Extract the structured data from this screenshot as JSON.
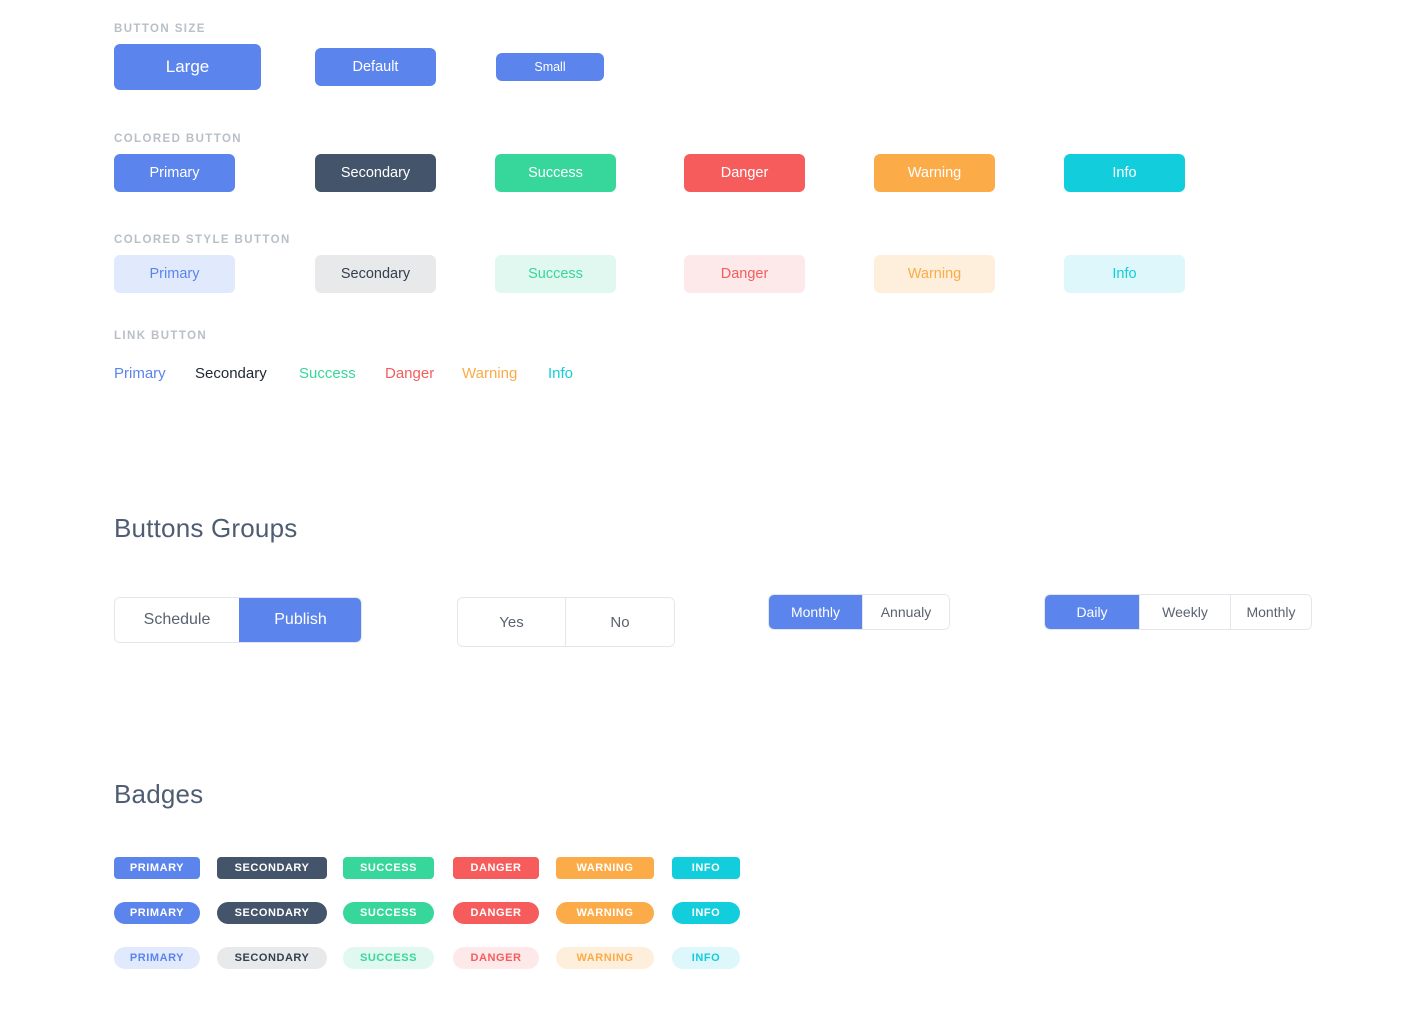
{
  "palette": {
    "primary": "#5b84ec",
    "secondary": "#44546b",
    "success": "#37d79b",
    "danger": "#f75c5c",
    "warning": "#fbab48",
    "info": "#12cedd",
    "primary_soft_bg": "#e1eafd",
    "secondary_soft_bg": "#e8e9eb",
    "success_soft_bg": "#e0f8ef",
    "danger_soft_bg": "#fde9e9",
    "warning_soft_bg": "#fdefdc",
    "info_soft_bg": "#ddf7fa",
    "secondary_soft_text": "#33404f",
    "link_secondary": "#1f2733",
    "label_gray": "#b9bfc7",
    "heading": "#4f5d73",
    "segment_text": "#5a6270",
    "segment_border": "#e3e7ec",
    "page_bg": "#ffffff"
  },
  "sections": {
    "button_size": {
      "label": "BUTTON SIZE",
      "buttons": [
        {
          "label": "Large",
          "size": "large"
        },
        {
          "label": "Default",
          "size": "default"
        },
        {
          "label": "Small",
          "size": "small"
        }
      ]
    },
    "colored_button": {
      "label": "COLORED BUTTON",
      "buttons": [
        {
          "label": "Primary",
          "variant": "primary"
        },
        {
          "label": "Secondary",
          "variant": "secondary"
        },
        {
          "label": "Success",
          "variant": "success"
        },
        {
          "label": "Danger",
          "variant": "danger"
        },
        {
          "label": "Warning",
          "variant": "warning"
        },
        {
          "label": "Info",
          "variant": "info"
        }
      ]
    },
    "colored_style_button": {
      "label": "COLORED STYLE BUTTON",
      "buttons": [
        {
          "label": "Primary",
          "variant": "primary"
        },
        {
          "label": "Secondary",
          "variant": "secondary"
        },
        {
          "label": "Success",
          "variant": "success"
        },
        {
          "label": "Danger",
          "variant": "danger"
        },
        {
          "label": "Warning",
          "variant": "warning"
        },
        {
          "label": "Info",
          "variant": "info"
        }
      ]
    },
    "link_button": {
      "label": "LINK BUTTON",
      "buttons": [
        {
          "label": "Primary",
          "variant": "primary"
        },
        {
          "label": "Secondary",
          "variant": "secondary"
        },
        {
          "label": "Success",
          "variant": "success"
        },
        {
          "label": "Danger",
          "variant": "danger"
        },
        {
          "label": "Warning",
          "variant": "warning"
        },
        {
          "label": "Info",
          "variant": "info"
        }
      ]
    },
    "buttons_groups": {
      "heading": "Buttons Groups",
      "groups": [
        {
          "name": "schedule-publish",
          "segments": [
            {
              "label": "Schedule",
              "active": false
            },
            {
              "label": "Publish",
              "active": true
            }
          ]
        },
        {
          "name": "yes-no",
          "segments": [
            {
              "label": "Yes",
              "active": false
            },
            {
              "label": "No",
              "active": false
            }
          ]
        },
        {
          "name": "monthly-annualy",
          "segments": [
            {
              "label": "Monthly",
              "active": true
            },
            {
              "label": "Annualy",
              "active": false
            }
          ]
        },
        {
          "name": "daily-weekly-monthly",
          "segments": [
            {
              "label": "Daily",
              "active": true
            },
            {
              "label": "Weekly",
              "active": false
            },
            {
              "label": "Monthly",
              "active": false
            }
          ]
        }
      ]
    },
    "badges": {
      "heading": "Badges",
      "rows": [
        {
          "style": "square-solid",
          "items": [
            {
              "label": "PRIMARY",
              "variant": "primary"
            },
            {
              "label": "SECONDARY",
              "variant": "secondary"
            },
            {
              "label": "SUCCESS",
              "variant": "success"
            },
            {
              "label": "DANGER",
              "variant": "danger"
            },
            {
              "label": "WARNING",
              "variant": "warning"
            },
            {
              "label": "INFO",
              "variant": "info"
            }
          ]
        },
        {
          "style": "pill-solid",
          "items": [
            {
              "label": "PRIMARY",
              "variant": "primary"
            },
            {
              "label": "SECONDARY",
              "variant": "secondary"
            },
            {
              "label": "SUCCESS",
              "variant": "success"
            },
            {
              "label": "DANGER",
              "variant": "danger"
            },
            {
              "label": "WARNING",
              "variant": "warning"
            },
            {
              "label": "INFO",
              "variant": "info"
            }
          ]
        },
        {
          "style": "pill-soft",
          "items": [
            {
              "label": "PRIMARY",
              "variant": "primary"
            },
            {
              "label": "SECONDARY",
              "variant": "secondary"
            },
            {
              "label": "SUCCESS",
              "variant": "success"
            },
            {
              "label": "DANGER",
              "variant": "danger"
            },
            {
              "label": "WARNING",
              "variant": "warning"
            },
            {
              "label": "INFO",
              "variant": "info"
            }
          ]
        }
      ]
    }
  }
}
